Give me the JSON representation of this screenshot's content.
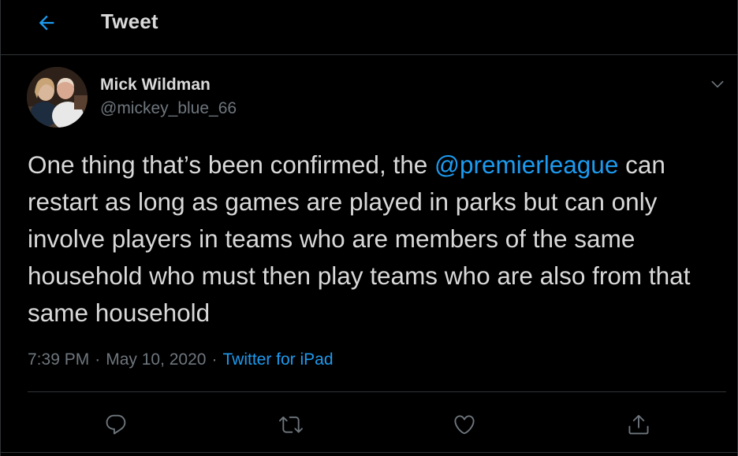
{
  "header": {
    "title": "Tweet",
    "back_icon": "arrow-left-icon"
  },
  "tweet": {
    "author": {
      "display_name": "Mick Wildman",
      "handle": "@mickey_blue_66",
      "avatar": "avatar-photo"
    },
    "text_before_mention": "One thing that’s been confirmed, the ",
    "mention": "@premierleague",
    "text_after_mention": " can restart as long as games are played in parks but can only involve players in teams who are members of the same household who must then play teams who are also from that same household",
    "time": "7:39 PM",
    "separator": "·",
    "date": "May 10, 2020",
    "source": "Twitter for iPad"
  },
  "actions": {
    "reply_icon": "reply-icon",
    "retweet_icon": "retweet-icon",
    "like_icon": "heart-icon",
    "share_icon": "share-icon",
    "more_icon": "chevron-down-icon"
  },
  "colors": {
    "background": "#000000",
    "text": "#d9d9d9",
    "secondary": "#6e767d",
    "accent": "#1d9bf0",
    "border": "#2f3336"
  }
}
